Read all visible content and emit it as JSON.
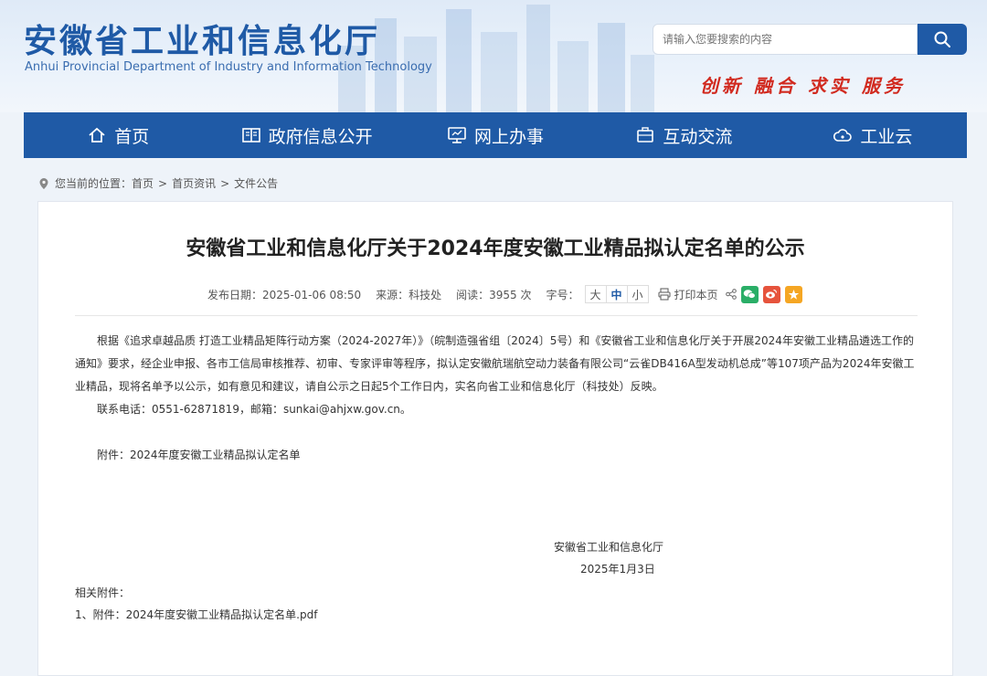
{
  "header": {
    "title": "安徽省工业和信息化厅",
    "subtitle": "Anhui Provincial Department of Industry and Information Technology",
    "search_placeholder": "请输入您要搜索的内容",
    "search_icon": "search-icon",
    "slogan": "创新 融合 求实 服务",
    "slogan_color": "#d12a1f",
    "brand_color": "#1f5aa6"
  },
  "nav": {
    "items": [
      {
        "label": "首页",
        "icon": "home-icon"
      },
      {
        "label": "政府信息公开",
        "icon": "book-icon"
      },
      {
        "label": "网上办事",
        "icon": "monitor-icon"
      },
      {
        "label": "互动交流",
        "icon": "briefcase-icon"
      },
      {
        "label": "工业云",
        "icon": "cloud-icon"
      }
    ]
  },
  "breadcrumb": {
    "prefix": "您当前的位置：",
    "items": [
      "首页",
      "首页资讯",
      "文件公告"
    ],
    "separator": ">"
  },
  "article": {
    "title": "安徽省工业和信息化厅关于2024年度安徽工业精品拟认定名单的公示",
    "meta": {
      "date": "发布日期：2025-01-06 08:50",
      "source": "来源：科技处",
      "views": "阅读：3955 次",
      "font_label": "字号：",
      "font_sizes": [
        "大",
        "中",
        "小"
      ],
      "print_label": "打印本页"
    },
    "paragraph1": "根据《追求卓越品质 打造工业精品矩阵行动方案（2024-2027年）》（皖制造强省组〔2024〕5号）和《安徽省工业和信息化厅关于开展2024年安徽工业精品遴选工作的通知》要求，经企业申报、各市工信局审核推荐、初审、专家评审等程序，拟认定安徽航瑞航空动力装备有限公司“云雀DB416A型发动机总成”等107项产品为2024年安徽工业精品，现将名单予以公示，如有意见和建议，请自公示之日起5个工作日内，实名向省工业和信息化厅（科技处）反映。",
    "paragraph2": "联系电话：0551-62871819，邮箱：sunkai@ahjxw.gov.cn。",
    "paragraph3": "附件：2024年度安徽工业精品拟认定名单",
    "signature": "安徽省工业和信息化厅",
    "sign_date": "2025年1月3日",
    "related_label": "相关附件：",
    "related_link": "1、附件：2024年度安徽工业精品拟认定名单.pdf"
  }
}
